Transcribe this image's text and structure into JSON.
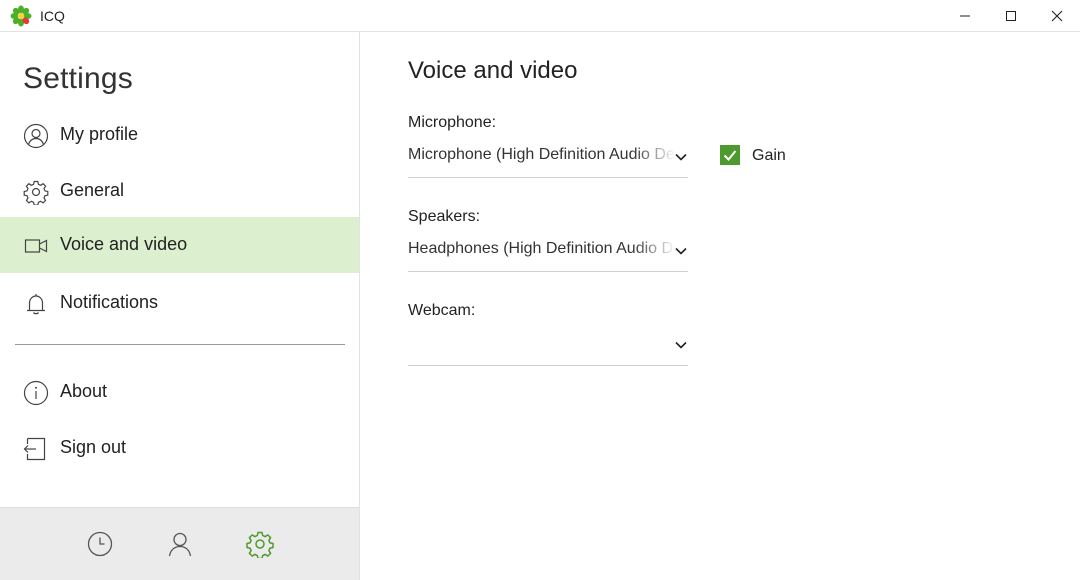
{
  "window": {
    "title": "ICQ",
    "controls": {
      "minimize": "minimize-icon",
      "maximize": "maximize-icon",
      "close": "close-icon"
    }
  },
  "sidebar": {
    "title": "Settings",
    "items": [
      {
        "label": "My profile",
        "icon": "user-circle-icon"
      },
      {
        "label": "General",
        "icon": "gear-icon"
      },
      {
        "label": "Voice and video",
        "icon": "video-camera-icon",
        "active": true
      },
      {
        "label": "Notifications",
        "icon": "bell-icon"
      },
      {
        "label": "About",
        "icon": "info-icon"
      },
      {
        "label": "Sign out",
        "icon": "sign-out-icon"
      }
    ],
    "bottom_tabs": [
      {
        "icon": "clock-icon"
      },
      {
        "icon": "contact-icon"
      },
      {
        "icon": "settings-gear-icon",
        "active": true
      }
    ]
  },
  "main": {
    "title": "Voice and video",
    "microphone": {
      "label": "Microphone:",
      "value": "Microphone (High Definition Audio Device)"
    },
    "gain": {
      "label": "Gain",
      "checked": true
    },
    "speakers": {
      "label": "Speakers:",
      "value": "Headphones (High Definition Audio Device)"
    },
    "webcam": {
      "label": "Webcam:",
      "value": ""
    }
  },
  "colors": {
    "accent_green": "#4e9a2e",
    "active_item_bg": "#dcefcf",
    "bottom_bar_bg": "#ebebeb"
  }
}
